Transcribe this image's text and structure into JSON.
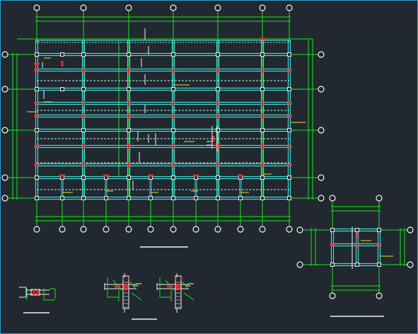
{
  "viewer": {
    "background": "#212830",
    "frame_color": "#2a9fd6"
  },
  "colors": {
    "axis_line": "#19e619",
    "beam": "#3fd9d4",
    "beam_dash": "#b8f0ee",
    "column_box": "#dfe6ea",
    "column_fill": "#2a3138",
    "red_mark": "#f0262a",
    "bubble": "#f2f2f2",
    "yellow_mark": "#f0e020",
    "white_line": "#f2f2f2",
    "dark_red": "#8b1b1b"
  },
  "drawing": {
    "name": "structural-framing-plan",
    "views": [
      "main-floor-plan",
      "small-plan-right",
      "detail-1",
      "detail-2",
      "detail-3"
    ]
  }
}
